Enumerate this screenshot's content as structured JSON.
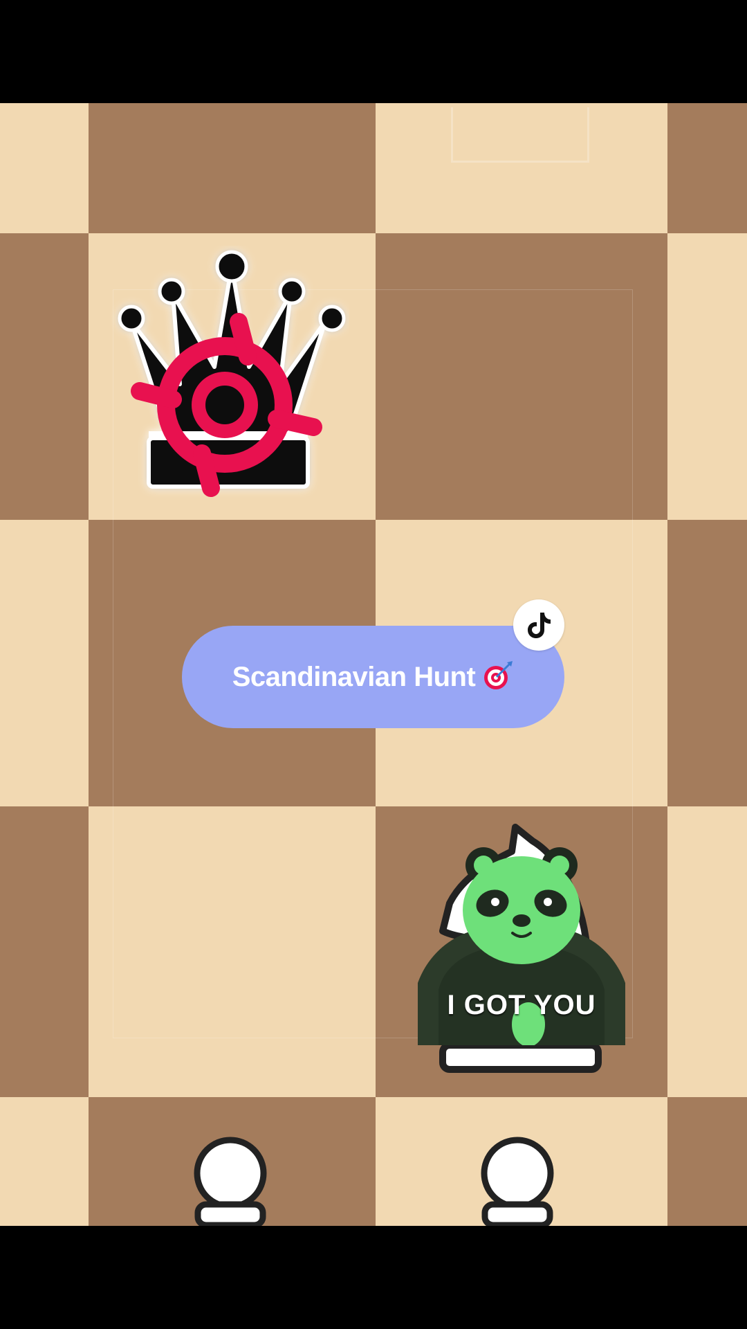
{
  "sticker": {
    "title": "Scandinavian Hunt",
    "emoji": "direct-hit-target-icon"
  },
  "panda_sticker": {
    "caption": "I GOT YOU"
  },
  "colors": {
    "light_square": "#f2d9b2",
    "dark_square": "#a47c5c",
    "pill": "#98a6f5",
    "target": "#e8114f",
    "panda_green": "#6ee07a"
  },
  "pieces": {
    "queen": "black-queen-icon",
    "knight": "white-knight-icon",
    "pawns": [
      "white-pawn-icon",
      "white-pawn-icon"
    ]
  }
}
